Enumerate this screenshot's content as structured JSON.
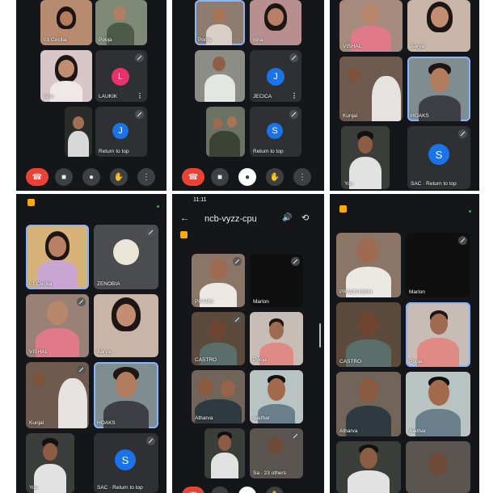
{
  "meeting": {
    "code": "ncb-vyzz-cpu",
    "time": "11:11",
    "return_to_top": "Return to top",
    "others": "23 others"
  },
  "participants": {
    "cecilia": "01 Cecilia",
    "pooja": "Pooja",
    "ishita": "Isha",
    "laukik": "LAUKIK",
    "jecica": "JECICA",
    "vishal": "VISHAL",
    "aarya": "Aarya",
    "kunjal": "Kunjal",
    "hoaks": "HOAKS",
    "you": "You",
    "sac": "SAC",
    "zenobia": "ZENOBIA",
    "pradnyesh": "PRADNYESH",
    "pradn": "PRADN",
    "marlon": "Marlon",
    "castro": "CASTRO",
    "atharva": "Atharva",
    "aadhar": "Aadhar",
    "sa": "Sa"
  },
  "avatars": {
    "laukik": "L",
    "jecica": "J",
    "s": "S",
    "j2": "J"
  },
  "colors": {
    "laukik": "#e8336a",
    "blue": "#1a73e8",
    "end": "#ea4335",
    "chat": "#f9ab00"
  },
  "icons": [
    "phone-hangup-icon",
    "camera-icon",
    "mic-icon",
    "hand-raise-icon",
    "more-options-icon",
    "back-arrow-icon",
    "volume-icon",
    "switch-camera-icon",
    "chat-icon"
  ]
}
